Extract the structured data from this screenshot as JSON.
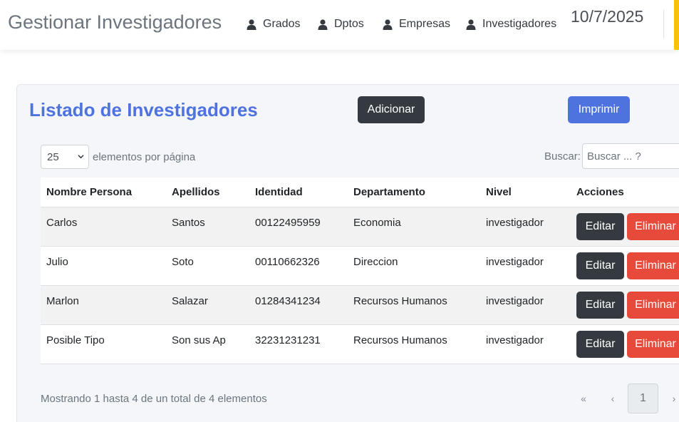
{
  "navbar": {
    "brand": "Gestionar Investigadores",
    "items": [
      {
        "label": "Grados",
        "icon": "user-icon"
      },
      {
        "label": "Dptos",
        "icon": "user-icon"
      },
      {
        "label": "Empresas",
        "icon": "user-icon"
      },
      {
        "label": "Investigadores",
        "icon": "user-icon"
      }
    ],
    "date": "10/7/2025"
  },
  "card": {
    "title": "Listado de Investigadores",
    "add_label": "Adicionar",
    "print_label": "Imprimir"
  },
  "controls": {
    "page_length": "25",
    "page_length_label": "elementos por página",
    "search_label": "Buscar:",
    "search_placeholder": "Buscar ... ?"
  },
  "table": {
    "columns": [
      "Nombre Persona",
      "Apellidos",
      "Identidad",
      "Departamento",
      "Nivel",
      "Acciones"
    ],
    "rows": [
      {
        "nombre": "Carlos",
        "apellidos": "Santos",
        "identidad": "00122495959",
        "departamento": "Economia",
        "nivel": "investigador"
      },
      {
        "nombre": "Julio",
        "apellidos": "Soto",
        "identidad": "00110662326",
        "departamento": "Direccion",
        "nivel": "investigador"
      },
      {
        "nombre": "Marlon",
        "apellidos": "Salazar",
        "identidad": "01284341234",
        "departamento": "Recursos Humanos",
        "nivel": "investigador"
      },
      {
        "nombre": "Posible Tipo",
        "apellidos": "Son sus Ap",
        "identidad": "32231231231",
        "departamento": "Recursos Humanos",
        "nivel": "investigador"
      }
    ],
    "edit_label": "Editar",
    "delete_label": "Eliminar"
  },
  "footer": {
    "info": "Mostrando 1 hasta 4 de un total de 4 elementos",
    "first": "«",
    "prev": "‹",
    "current_page": "1",
    "next": "›"
  },
  "colors": {
    "accent": "#4e73df",
    "danger": "#e74a3b",
    "dark": "#343a40",
    "warning_stripe": "#ffc107"
  }
}
